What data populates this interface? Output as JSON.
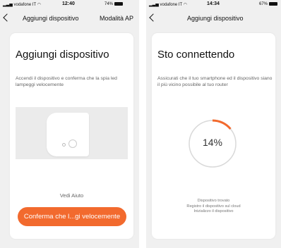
{
  "left_screen": {
    "status": {
      "carrier": "vodafone IT",
      "time": "12:40",
      "battery": "74%"
    },
    "nav": {
      "title": "Aggiungi dispositivo",
      "right": "Modalità AP"
    },
    "title": "Aggiungi dispositivo",
    "description": "Accendi il dispositivo e conferma che la spia led lampeggi velocemente",
    "help_link": "Vedi Aiuto",
    "confirm_button": "Conferma che l...gi velocemente"
  },
  "right_screen": {
    "status": {
      "carrier": "vodafone IT",
      "time": "14:34",
      "battery": "67%"
    },
    "nav": {
      "title": "Aggiungi dispositivo"
    },
    "title": "Sto connettendo",
    "description": "Assicurati che il tuo smartphone ed il dispositivo siano il più vicino possibile al tuo router",
    "progress": {
      "value": 14,
      "label": "14%"
    },
    "steps": [
      "Dispositivo trovato",
      "Registro il dispositivo sul cloud",
      "Inizializzo il dispositivo"
    ]
  },
  "colors": {
    "accent": "#f26a2e",
    "background": "#f0f0f0",
    "card": "#ffffff",
    "ring_track": "#d9d9d9"
  },
  "icons": {
    "back": "chevron-left-icon",
    "signal": "signal-icon",
    "wifi": "wifi-icon",
    "battery": "battery-icon"
  }
}
